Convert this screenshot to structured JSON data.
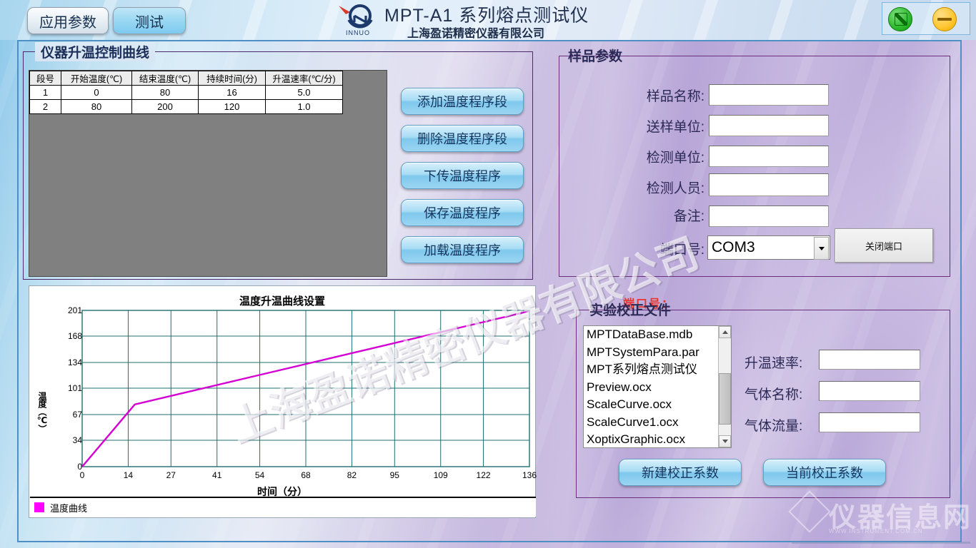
{
  "header": {
    "tabs": [
      {
        "label": "应用参数",
        "active": false
      },
      {
        "label": "测试",
        "active": true
      }
    ],
    "logo_alt": "INNUO",
    "logo_text": "INNUO",
    "title": "MPT-A1 系列熔点测试仪",
    "subtitle": "上海盈诺精密仪器有限公司",
    "window_buttons": [
      {
        "name": "exit",
        "color": "#2db92d"
      },
      {
        "name": "minimize",
        "color": "#ffc52e"
      }
    ]
  },
  "curve_panel": {
    "title": "仪器升温控制曲线",
    "table": {
      "headers": [
        "段号",
        "开始温度(℃)",
        "结束温度(℃)",
        "持续时间(分)",
        "升温速率(℃/分)"
      ],
      "rows": [
        [
          "1",
          "0",
          "80",
          "16",
          "5.0"
        ],
        [
          "2",
          "80",
          "200",
          "120",
          "1.0"
        ]
      ]
    },
    "buttons": [
      "添加温度程序段",
      "删除温度程序段",
      "下传温度程序",
      "保存温度程序",
      "加载温度程序"
    ]
  },
  "sample_panel": {
    "title": "样品参数",
    "fields": [
      {
        "label": "样品名称:",
        "value": "",
        "focused": true
      },
      {
        "label": "送样单位:",
        "value": ""
      },
      {
        "label": "检测单位:",
        "value": ""
      },
      {
        "label": "检测人员:",
        "value": ""
      },
      {
        "label": "备注:",
        "value": ""
      }
    ],
    "port": {
      "label": "端口号:",
      "value": "COM3",
      "close_button": "关闭端口"
    },
    "port_note": "端口号："
  },
  "calibration_panel": {
    "title": "实验校正文件",
    "files": [
      "MPTDataBase.mdb",
      "MPTSystemPara.par",
      "MPT系列熔点测试仪",
      "Preview.ocx",
      "ScaleCurve.ocx",
      "ScaleCurve1.ocx",
      "XoptixGraphic.ocx"
    ],
    "fields": [
      {
        "label": "升温速率:",
        "value": ""
      },
      {
        "label": "气体名称:",
        "value": ""
      },
      {
        "label": "气体流量:",
        "value": ""
      }
    ],
    "buttons": [
      "新建校正系数",
      "当前校正系数"
    ]
  },
  "watermarks": {
    "diagonal": "上海盈诺精密仪器有限公司",
    "bottom_right": "仪器信息网",
    "bottom_right_sub": "WWW.INSTRUMENT.COM.CN"
  },
  "chart_data": {
    "type": "line",
    "title": "温度升温曲线设置",
    "xlabel": "时间（分）",
    "ylabel": "温度（℃）",
    "xticks": [
      0,
      14,
      27,
      41,
      54,
      68,
      82,
      95,
      109,
      122,
      136
    ],
    "yticks": [
      0,
      34,
      67,
      101,
      134,
      168,
      201
    ],
    "xlim": [
      0,
      136
    ],
    "ylim": [
      0,
      201
    ],
    "grid": true,
    "legend": [
      "温度曲线"
    ],
    "series": [
      {
        "name": "温度曲线",
        "color": "#d400d4",
        "x": [
          0,
          16,
          136
        ],
        "y": [
          0,
          80,
          200
        ]
      }
    ]
  }
}
